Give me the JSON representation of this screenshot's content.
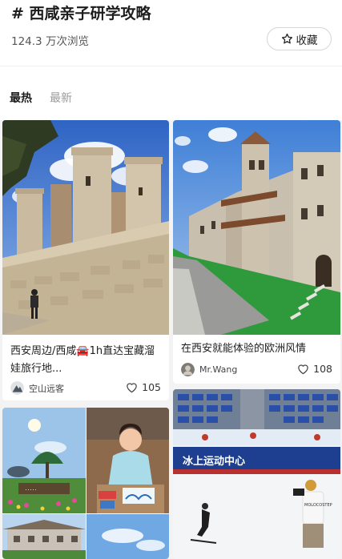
{
  "header": {
    "title": "# 西咸亲子研学攻略",
    "views": "124.3 万次浏览",
    "favorite_label": "收藏"
  },
  "tabs": [
    {
      "label": "最热",
      "active": true
    },
    {
      "label": "最新",
      "active": false
    }
  ],
  "posts": [
    {
      "title": "西安周边/西咸🚘1h直达宝藏溜娃旅行地...",
      "author": "空山远客",
      "likes": "105",
      "image": "castle-wall-photo"
    },
    {
      "title": "在西安就能体验的欧洲风情",
      "author": "Mr.Wang",
      "likes": "108",
      "image": "stone-castle-lawn-photo"
    },
    {
      "title": "",
      "author": "",
      "likes": "",
      "image": "garden-and-child-painting-collage"
    },
    {
      "title": "",
      "author": "",
      "likes": "",
      "image": "ice-sports-center-photo",
      "sign_text": "冰上运动中心",
      "shirt_text": "MOLOCOSTEP"
    }
  ],
  "colors": {
    "accent_text": "#1d1d1d",
    "muted_text": "#9b9b9b",
    "feed_background": "#f3f3f3"
  }
}
